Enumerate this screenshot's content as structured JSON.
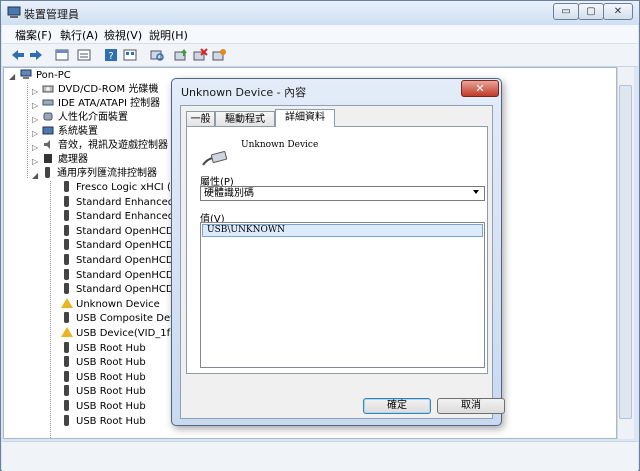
{
  "window": {
    "title": "裝置管理員",
    "caption_buttons": {
      "minimize": "▭",
      "maximize": "▢",
      "close": "✕"
    }
  },
  "menu": [
    "檔案(F)",
    "執行(A)",
    "檢視(V)",
    "說明(H)"
  ],
  "toolbar": [
    "back-icon",
    "forward-icon",
    "properties-icon",
    "console-icon",
    "help-icon",
    "view-icon",
    "scan-icon",
    "update-driver-icon",
    "uninstall-icon",
    "disable-icon"
  ],
  "tree": {
    "root": "Pon-PC",
    "categories": [
      "DVD/CD-ROM 光碟機",
      "IDE ATA/ATAPI 控制器",
      "人性化介面裝置",
      "系統裝置",
      "音效，視訊及遊戲控制器",
      "處理器",
      "通用序列匯流排控制器"
    ],
    "usb_devices": [
      {
        "label": "Fresco Logic xHCI (US",
        "warn": false
      },
      {
        "label": "Standard Enhanced P",
        "warn": false
      },
      {
        "label": "Standard Enhanced P",
        "warn": false
      },
      {
        "label": "Standard OpenHCD U",
        "warn": false
      },
      {
        "label": "Standard OpenHCD U",
        "warn": false
      },
      {
        "label": "Standard OpenHCD U",
        "warn": false
      },
      {
        "label": "Standard OpenHCD U",
        "warn": false
      },
      {
        "label": "Standard OpenHCD U",
        "warn": false
      },
      {
        "label": "Unknown Device",
        "warn": true
      },
      {
        "label": "USB Composite Device",
        "warn": false
      },
      {
        "label": "USB Device(VID_1f3a_",
        "warn": true
      },
      {
        "label": "USB Root Hub",
        "warn": false
      },
      {
        "label": "USB Root Hub",
        "warn": false
      },
      {
        "label": "USB Root Hub",
        "warn": false
      },
      {
        "label": "USB Root Hub",
        "warn": false
      },
      {
        "label": "USB Root Hub",
        "warn": false
      },
      {
        "label": "USB Root Hub",
        "warn": false
      }
    ]
  },
  "dialog": {
    "title": "Unknown Device - 內容",
    "close": "✕",
    "tabs": {
      "general": "一般",
      "driver": "驅動程式",
      "details": "詳細資料"
    },
    "device_name": "Unknown Device",
    "property_label": "屬性(P)",
    "property_value": "硬體識別碼",
    "value_label": "值(V)",
    "value_item": "USB\\UNKNOWN",
    "ok": "確定",
    "cancel": "取消"
  },
  "colors": {
    "accent": "#3c7fb1",
    "warning": "#e9b522",
    "close_red": "#c0392b"
  }
}
